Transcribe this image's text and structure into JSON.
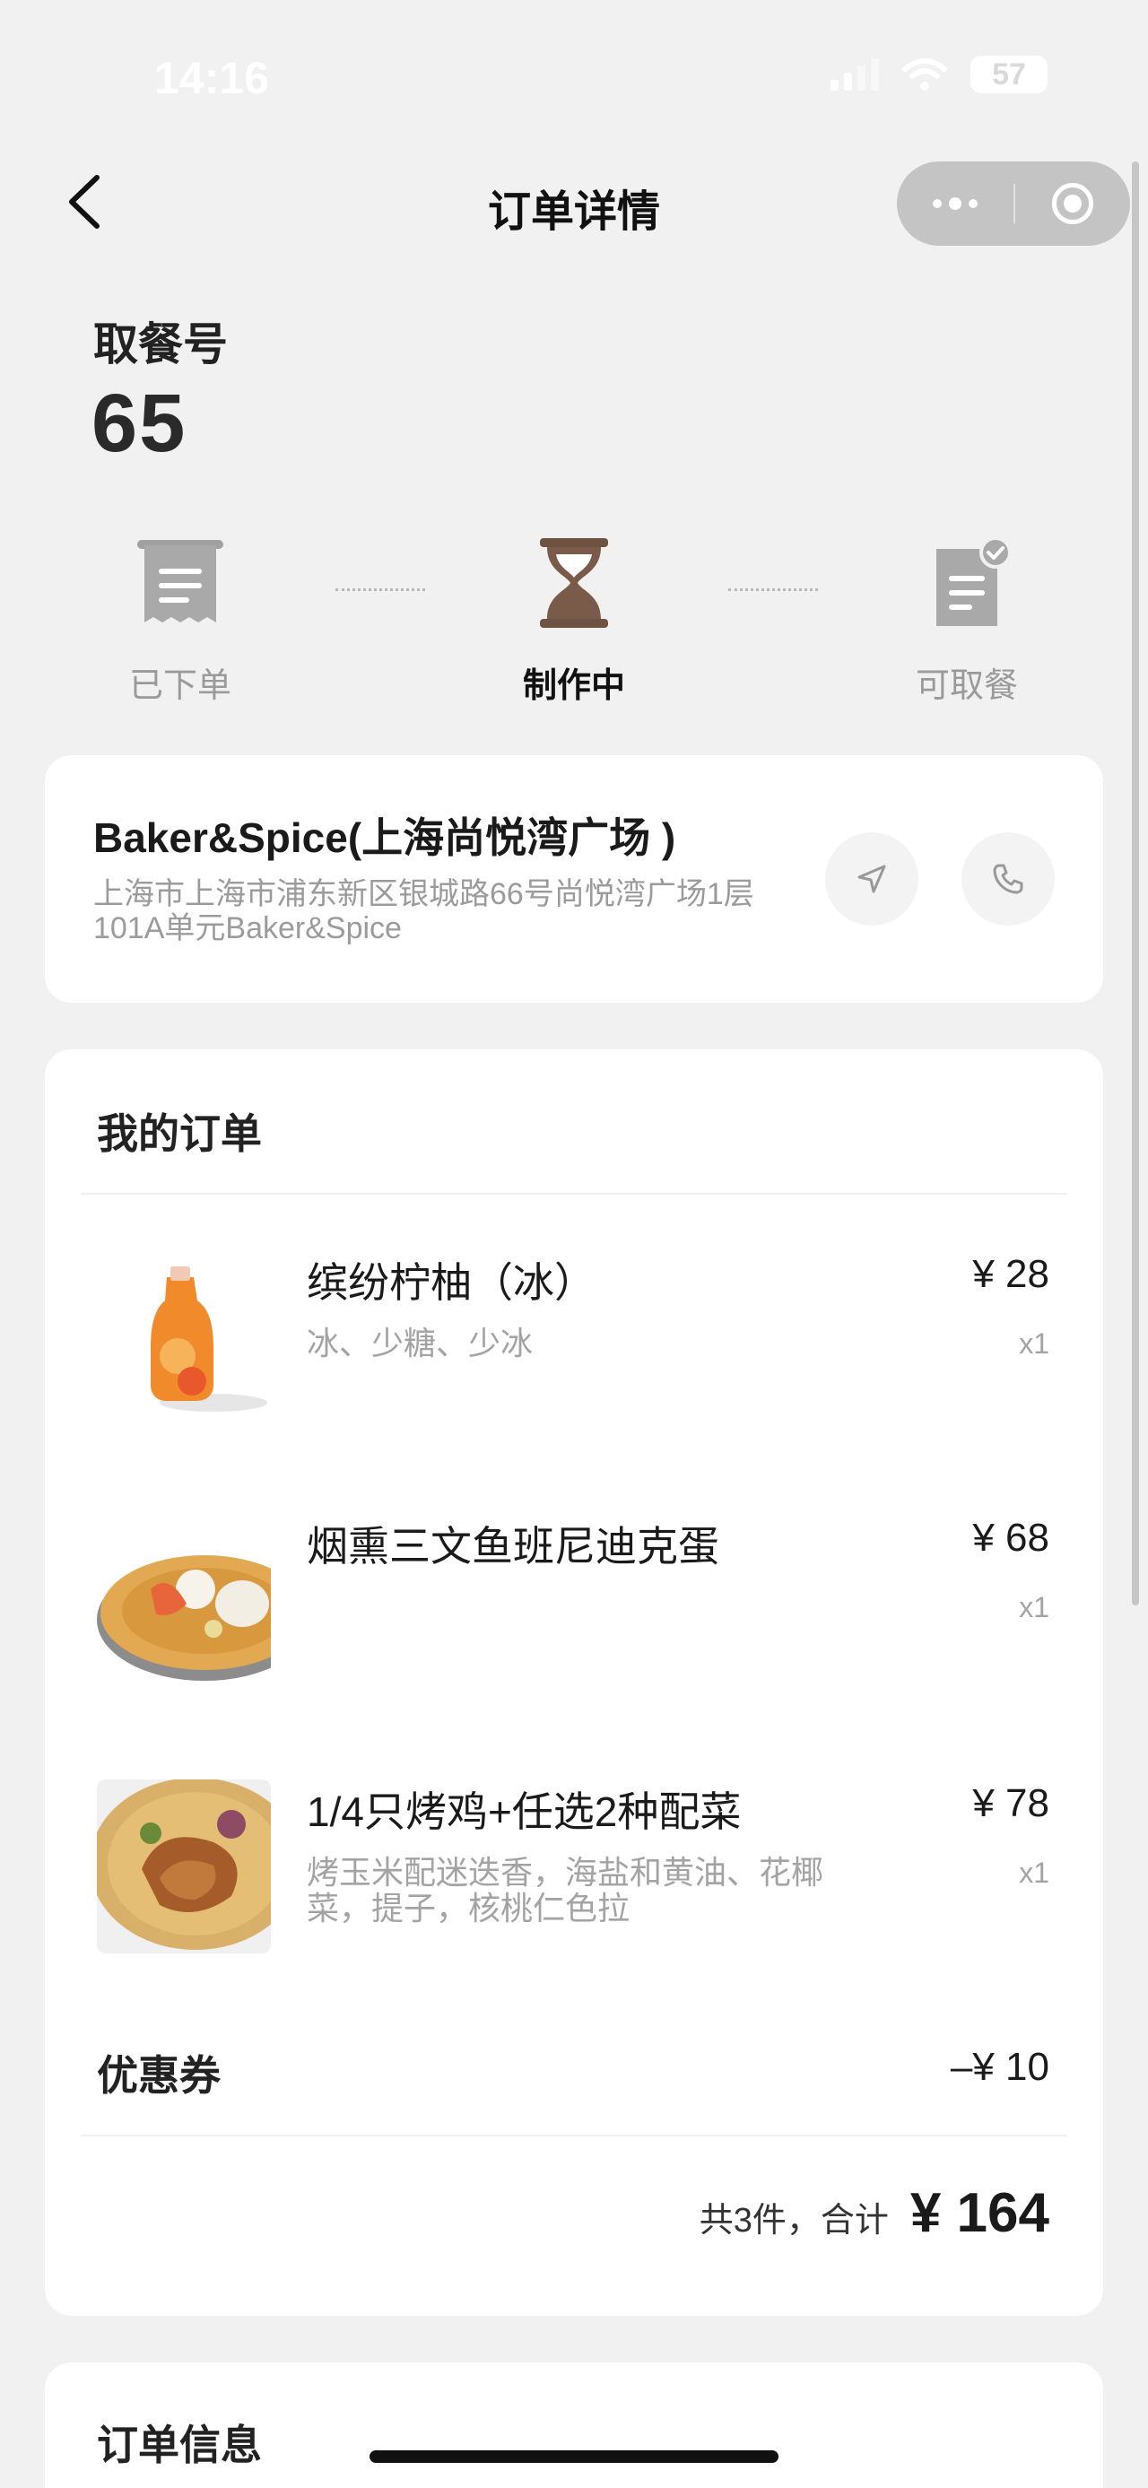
{
  "status_bar": {
    "time": "14:16",
    "battery": "57"
  },
  "nav": {
    "title": "订单详情"
  },
  "pickup": {
    "label": "取餐号",
    "number": "65"
  },
  "steps": [
    {
      "label": "已下单",
      "icon": "receipt-icon"
    },
    {
      "label": "制作中",
      "icon": "hourglass-icon"
    },
    {
      "label": "可取餐",
      "icon": "document-check-icon"
    }
  ],
  "store": {
    "name": "Baker&Spice(上海尚悦湾广场 )",
    "address": "上海市上海市浦东新区银城路66号尚悦湾广场1层101A单元Baker&Spice"
  },
  "order": {
    "title": "我的订单",
    "items": [
      {
        "name": "缤纷柠柚（冰）",
        "options": "冰、少糖、少冰",
        "price": "¥ 28",
        "qty": "x1"
      },
      {
        "name": "烟熏三文鱼班尼迪克蛋",
        "options": "",
        "price": "¥ 68",
        "qty": "x1"
      },
      {
        "name": "1/4只烤鸡+任选2种配菜",
        "options": "烤玉米配迷迭香，海盐和黄油、花椰菜，提子，核桃仁色拉",
        "price": "¥ 78",
        "qty": "x1"
      }
    ],
    "coupon_label": "优惠券",
    "coupon_value": "–¥ 10",
    "summary_label": "共3件，合计",
    "total": "¥ 164"
  },
  "order_info": {
    "title": "订单信息"
  },
  "colors": {
    "background": "#f2f1f1",
    "accent_brown": "#7a5a48",
    "muted": "#9a9a9a"
  }
}
